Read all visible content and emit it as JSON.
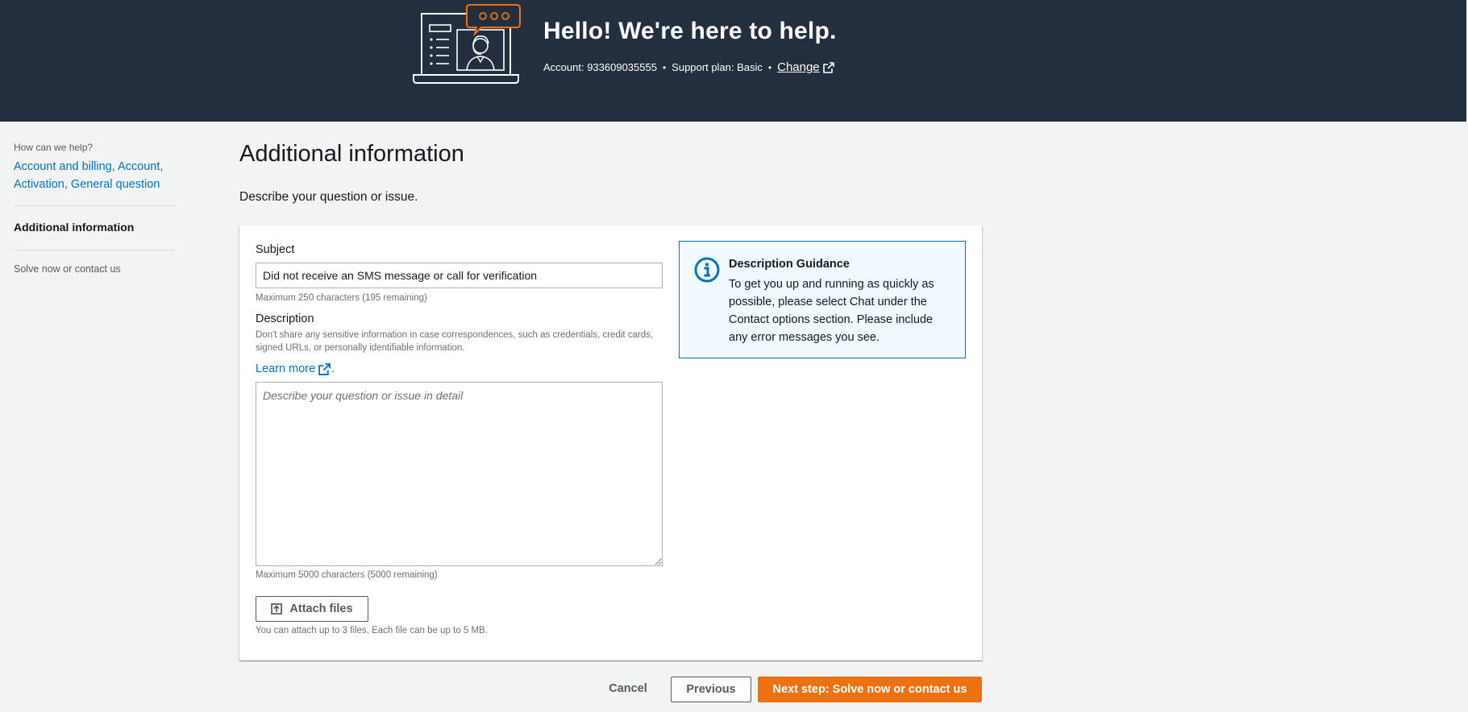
{
  "header": {
    "greeting": "Hello!  We're here to help.",
    "account": "Account: 933609035555",
    "support_plan": "Support plan: Basic",
    "change_link": "Change",
    "separator": "•",
    "background_color": "#232f3e"
  },
  "sidebar": {
    "question": "How can we help?",
    "selection": "Account and billing, Account, Activation, General question",
    "steps": [
      {
        "label": "Additional information",
        "state": "active"
      },
      {
        "label": "Solve now or contact us",
        "state": "upcoming"
      }
    ]
  },
  "main": {
    "title": "Additional information",
    "subtitle": "Describe your question or issue.",
    "subject": {
      "label": "Subject",
      "value": "Did not receive an SMS message or call for verification",
      "constraint": "Maximum 250 characters (195 remaining)"
    },
    "description": {
      "label": "Description",
      "help": "Don't share any sensitive information in case correspondences, such as credentials, credit cards, signed URLs, or personally identifiable information.",
      "learn_more": "Learn more",
      "learn_more_suffix": ".",
      "placeholder": "Describe your question or issue in detail",
      "constraint": "Maximum 5000 characters (5000 remaining)"
    },
    "attach": {
      "label": "Attach files",
      "hint": "You can attach up to 3 files. Each file can be up to 5 MB."
    },
    "guidance": {
      "title": "Description Guidance",
      "body": "To get you up and running as quickly as possible, please select Chat under the Contact options section. Please include any error messages you see."
    }
  },
  "footer": {
    "cancel": "Cancel",
    "previous": "Previous",
    "next": "Next step: Solve now or contact us"
  },
  "colors": {
    "link": "#0073bb",
    "primary_button": "#ec7211",
    "info_border": "#0073bb",
    "info_background": "#f1faff"
  },
  "icons": {
    "header_illustration": "support-agent-illustration-icon",
    "external_link": "external-link-icon",
    "info": "info-icon",
    "upload": "upload-icon",
    "cursor": "mouse-cursor-icon"
  }
}
